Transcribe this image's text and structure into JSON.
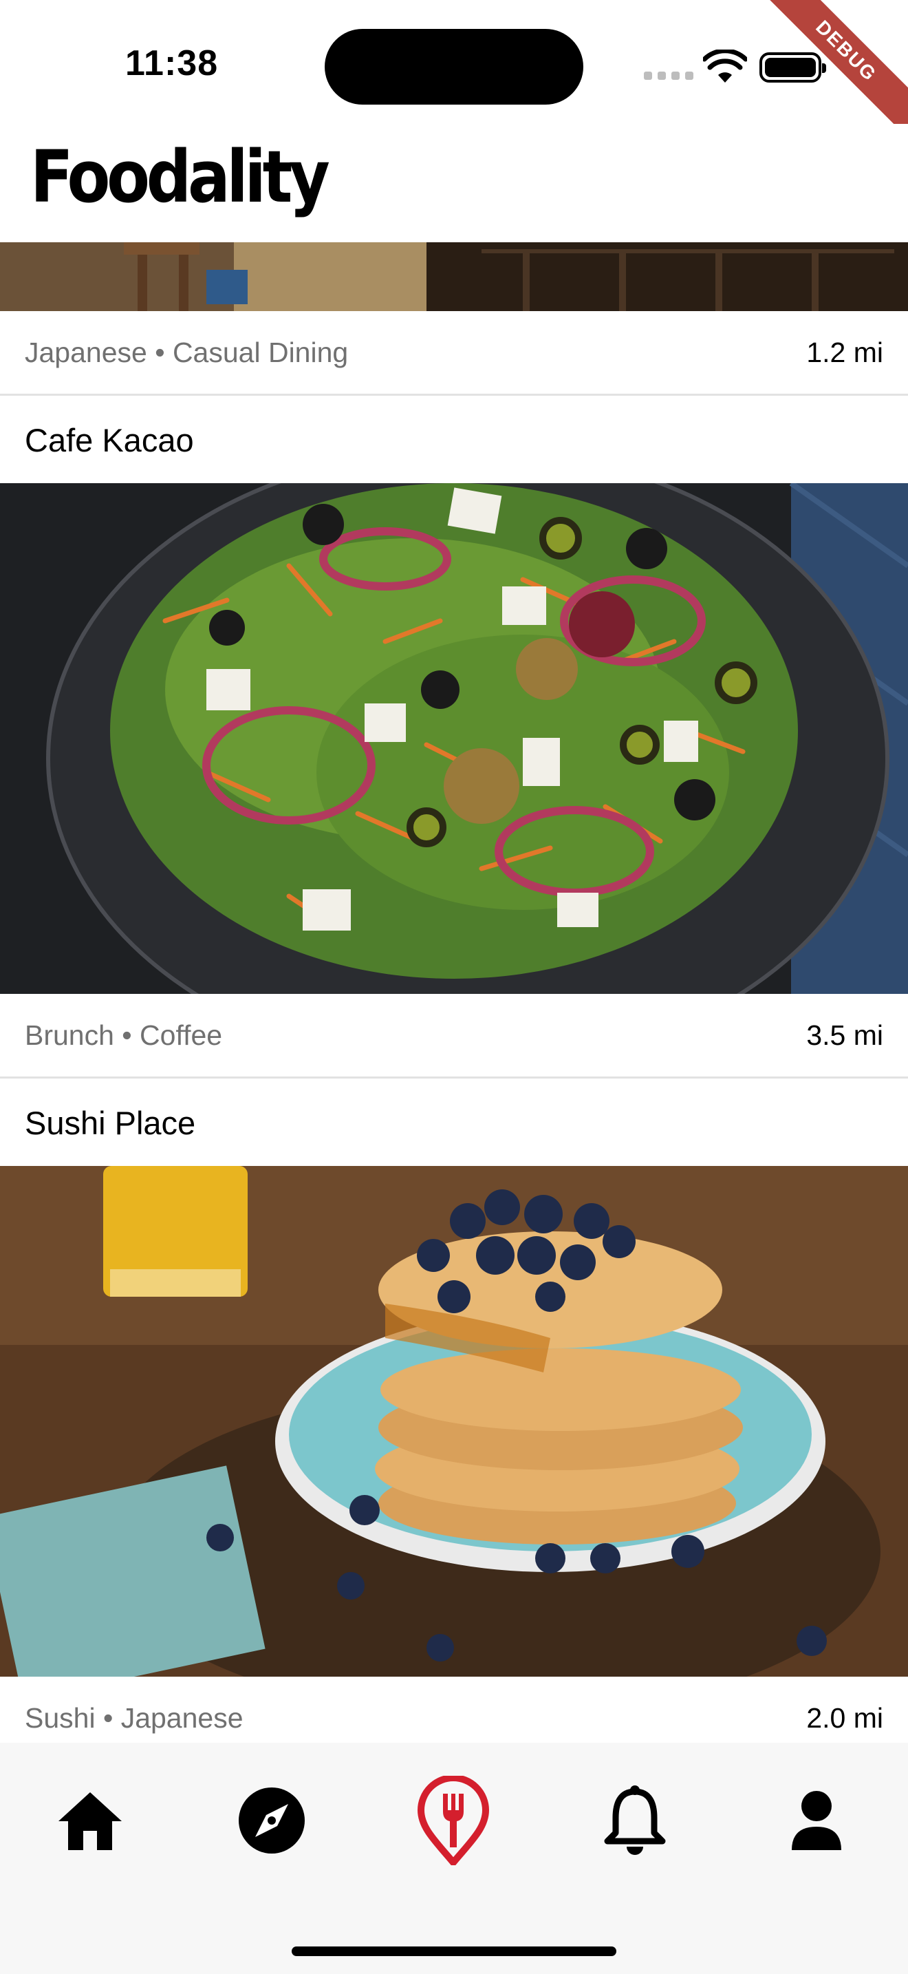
{
  "status": {
    "time": "11:38",
    "debug_label": "DEBUG"
  },
  "app": {
    "title": "Foodality"
  },
  "feed": {
    "partial_card": {
      "cuisine": "Japanese • Casual Dining",
      "distance": "1.2 mi",
      "image": "restaurant-interior"
    },
    "cards": [
      {
        "name": "Cafe Kacao",
        "cuisine": "Brunch • Coffee",
        "distance": "3.5 mi",
        "image": "salad-plate"
      },
      {
        "name": "Sushi Place",
        "cuisine": "Sushi • Japanese",
        "distance": "2.0 mi",
        "image": "blueberry-pancakes"
      }
    ]
  },
  "nav": {
    "items": [
      {
        "icon": "home-icon",
        "active": false
      },
      {
        "icon": "compass-icon",
        "active": false
      },
      {
        "icon": "fork-pin-icon",
        "active": true
      },
      {
        "icon": "bell-icon",
        "active": false
      },
      {
        "icon": "person-icon",
        "active": false
      }
    ]
  },
  "colors": {
    "accent": "#d41f2d",
    "muted_text": "#707070",
    "nav_bg": "#f7f7f7",
    "debug": "#b5443c"
  }
}
